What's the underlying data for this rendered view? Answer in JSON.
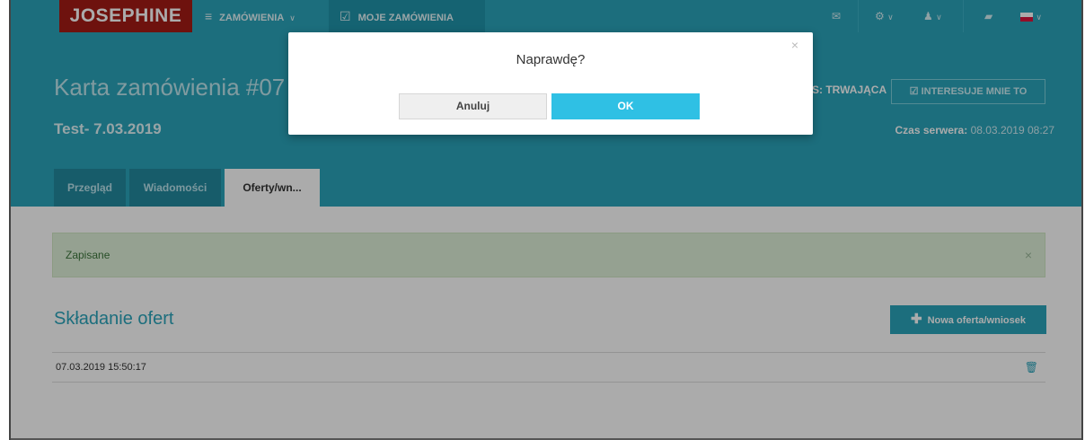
{
  "topbar": {
    "logo": "JOSEPHINE",
    "nav_orders": {
      "icon": "menu-icon",
      "label": "ZAMÓWIENIA"
    },
    "nav_my_orders": {
      "icon": "checkbox-icon",
      "label": "MOJE ZAMÓWIENIA"
    },
    "right_icons": [
      "mail-icon",
      "gear-icon",
      "user-icon",
      "book-icon",
      "flag-pl-icon"
    ]
  },
  "header": {
    "title": "Karta zamówienia #07",
    "subtitle": "Test- 7.03.2019",
    "status": "S: TRWAJĄCA",
    "interest_button": "INTERESUJE MNIE TO",
    "server_time_label": "Czas serwera:",
    "server_time_value": "08.03.2019 08:27",
    "tabs": [
      {
        "label": "Przegląd",
        "active": false
      },
      {
        "label": "Wiadomości",
        "active": false
      },
      {
        "label": "Oferty/wn...",
        "active": true
      }
    ]
  },
  "content": {
    "alert": {
      "text": "Zapisane",
      "close": "×"
    },
    "section_title": "Składanie ofert",
    "new_button": "Nowa oferta/wniosek",
    "rows": [
      {
        "date": "07.03.2019 15:50:17"
      }
    ]
  },
  "modal": {
    "title": "Naprawdę?",
    "close": "×",
    "cancel": "Anuluj",
    "ok": "OK"
  },
  "colors": {
    "header": "#2ba4bb",
    "logo": "#a51c16",
    "ok_button": "#2fc0e4",
    "alert_bg": "#dff0d8"
  }
}
